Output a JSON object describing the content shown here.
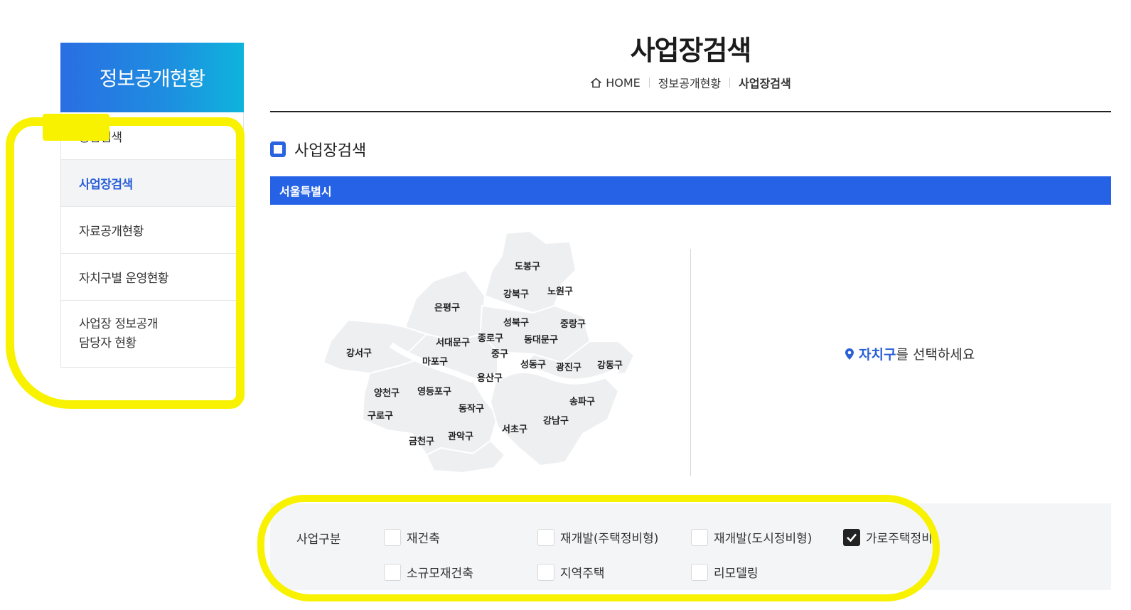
{
  "sidebar": {
    "title": "정보공개현황",
    "items": [
      {
        "label": "통합검색"
      },
      {
        "label": "사업장검색"
      },
      {
        "label": "자료공개현황"
      },
      {
        "label": "자치구별 운영현황"
      },
      {
        "label": "사업장 정보공개\n담당자 현황"
      }
    ]
  },
  "header": {
    "title": "사업장검색",
    "breadcrumb": [
      "HOME",
      "정보공개현황",
      "사업장검색"
    ]
  },
  "section": {
    "title": "사업장검색",
    "city": "서울특별시"
  },
  "map": {
    "districts": [
      "도봉구",
      "강북구",
      "노원구",
      "은평구",
      "성북구",
      "중랑구",
      "서대문구",
      "종로구",
      "동대문구",
      "중구",
      "강서구",
      "마포구",
      "성동구",
      "광진구",
      "강동구",
      "용산구",
      "양천구",
      "영등포구",
      "송파구",
      "동작구",
      "구로구",
      "강남구",
      "서초구",
      "관악구",
      "금천구"
    ]
  },
  "prompt": {
    "strong": "자치구",
    "rest": "를 선택하세요"
  },
  "filter": {
    "label": "사업구분",
    "options": [
      {
        "label": "재건축",
        "checked": false
      },
      {
        "label": "재개발(주택정비형)",
        "checked": false
      },
      {
        "label": "재개발(도시정비형)",
        "checked": false
      },
      {
        "label": "가로주택정비",
        "checked": true
      },
      {
        "label": "소규모재건축",
        "checked": false
      },
      {
        "label": "지역주택",
        "checked": false
      },
      {
        "label": "리모델링",
        "checked": false
      }
    ]
  },
  "colors": {
    "accent": "#2562e6",
    "highlight": "#f8f200"
  },
  "icons": {
    "home": "home-icon",
    "pin": "location-pin-icon",
    "check": "check-icon"
  }
}
